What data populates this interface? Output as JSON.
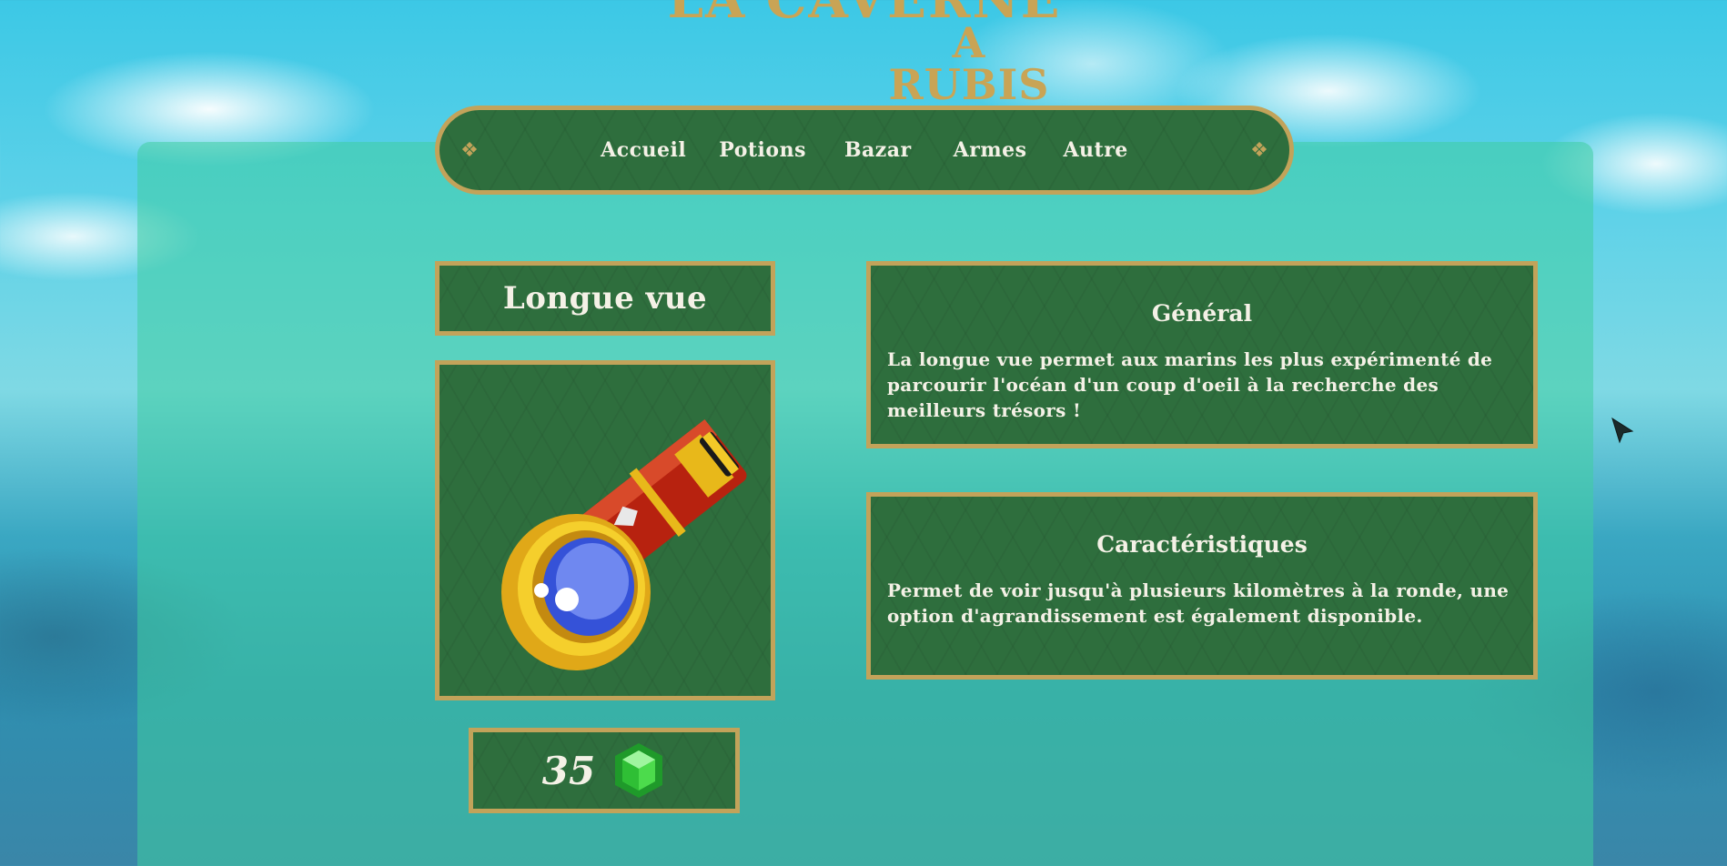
{
  "logo": {
    "line1": "LA CAVERNE",
    "line2": "A RUBIS"
  },
  "nav": {
    "items": [
      {
        "label": "Accueil"
      },
      {
        "label": "Potions"
      },
      {
        "label": "Bazar"
      },
      {
        "label": "Armes"
      },
      {
        "label": "Autre"
      }
    ],
    "ornament_icon": "gold-diamond-ornament-icon"
  },
  "product": {
    "name": "Longue vue",
    "image_icon": "telescope-icon",
    "price": "35",
    "currency_icon": "green-rupee-icon"
  },
  "general": {
    "title": "Général",
    "text": "La longue vue permet aux marins les plus expérimenté de parcourir l'océan d'un coup d'oeil à la recherche des meilleurs trésors !"
  },
  "characteristics": {
    "title": "Caractéristiques",
    "text": "Permet de voir jusqu'à plusieurs kilomètres à la ronde, une option d'agrandissement est également disponible."
  },
  "colors": {
    "panel_green": "#2e6e3d",
    "gold_border": "#c2a35a",
    "text": "#f4f1e6"
  }
}
